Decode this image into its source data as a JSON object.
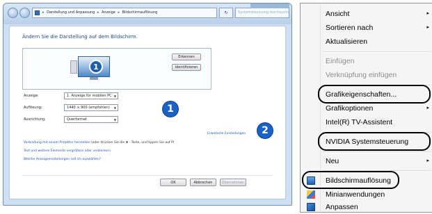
{
  "window": {
    "breadcrumb": [
      "Darstellung und Anpassung",
      "Anzeige",
      "Bildschirmauflösung"
    ],
    "search_placeholder": "Systemsteuerung durchsuchen",
    "refresh_glyph": "↻",
    "heading": "Ändern Sie die Darstellung auf dem Bildschirm.",
    "monitor_number": "1",
    "detect_button": "Erkennen",
    "identify_button": "Identifizieren",
    "fields": [
      {
        "label": "Anzeige:",
        "value": "1. Anzeige für mobilen PC"
      },
      {
        "label": "Auflösung:",
        "value": "1440 × 900 (empfohlen)"
      },
      {
        "label": "Ausrichtung:",
        "value": "Querformat"
      }
    ],
    "advanced_link": "Erweiterte Einstellungen",
    "projector_link": "Verbindung mit einem Projektor herstellen",
    "projector_hint": "(oder drücken Sie die",
    "projector_hint_2": "- Taste, und tippen Sie auf P)",
    "text_link": "Text und weitere Elemente vergrößern oder verkleinern",
    "help_link": "Welche Anzeigeeinstellungen soll ich auswählen?",
    "buttons": {
      "ok": "OK",
      "cancel": "Abbrechen",
      "apply": "Übernehmen"
    },
    "badges": {
      "one": "1",
      "two": "2"
    }
  },
  "context_menu": {
    "items": [
      {
        "label": "Ansicht",
        "submenu": true
      },
      {
        "label": "Sortieren nach",
        "submenu": true
      },
      {
        "label": "Aktualisieren"
      },
      {
        "label": "Einfügen",
        "disabled": true
      },
      {
        "label": "Verknüpfung einfügen",
        "disabled": true
      },
      {
        "label": "Grafikeigenschaften...",
        "highlighted": true
      },
      {
        "label": "Grafikoptionen",
        "submenu": true
      },
      {
        "label": "Intel(R) TV-Assistent"
      },
      {
        "label": "NVIDIA Systemsteuerung",
        "highlighted": true
      },
      {
        "label": "Neu",
        "submenu": true
      },
      {
        "label": "Bildschirmauflösung",
        "highlighted": true,
        "icon": "display-icon"
      },
      {
        "label": "Minianwendungen",
        "icon": "gadgets-icon"
      },
      {
        "label": "Anpassen",
        "icon": "personalize-icon"
      }
    ],
    "submenu_glyph": "▸"
  },
  "colors": {
    "accent": "#1b62c8",
    "link": "#1f57b5",
    "menu_bg": "#f5f5f5"
  }
}
